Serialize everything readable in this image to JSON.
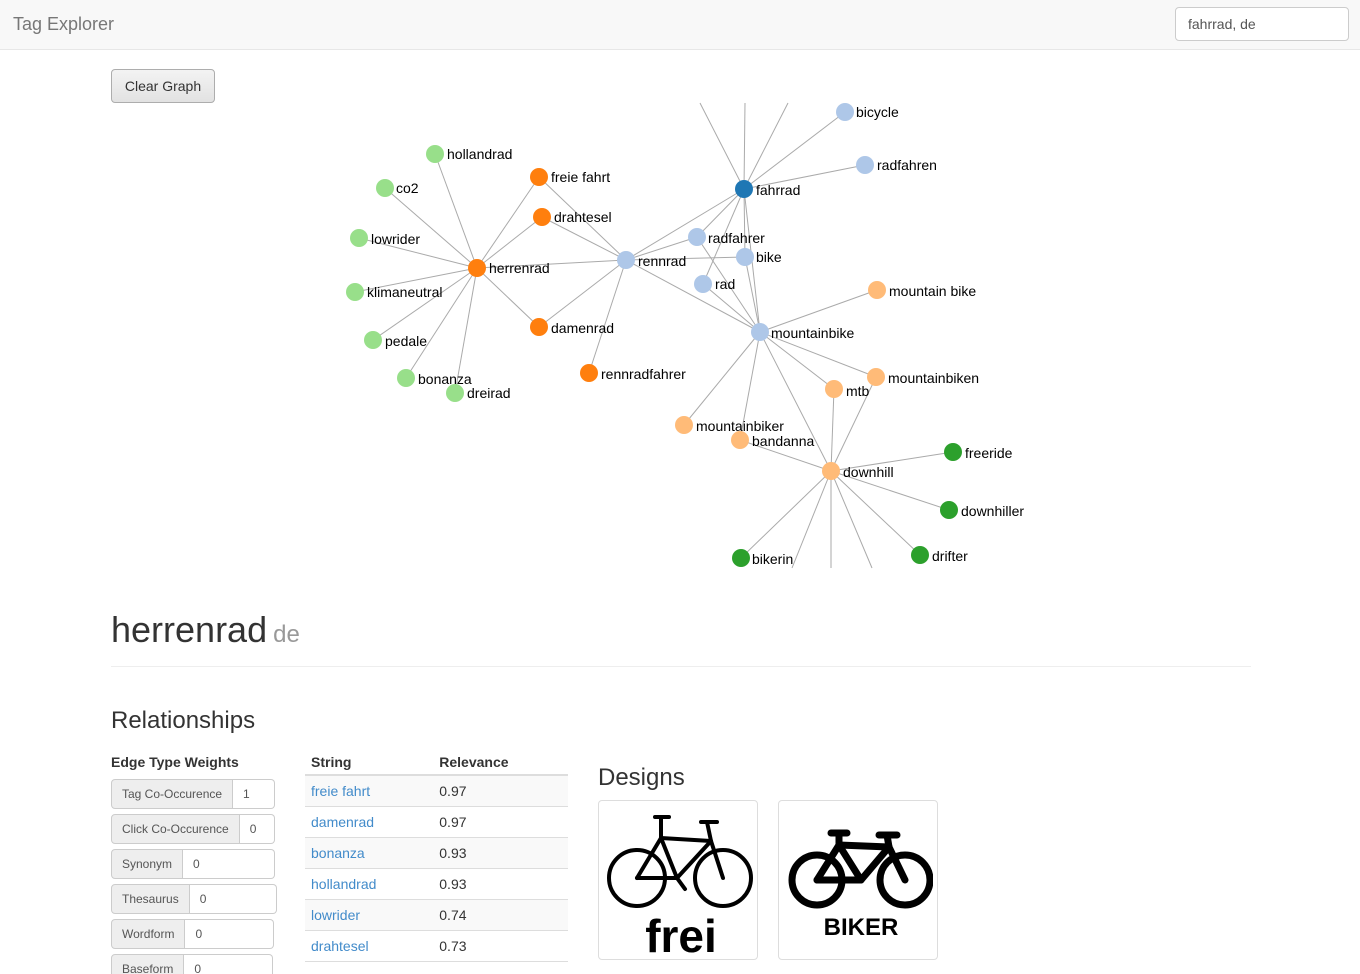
{
  "navbar": {
    "brand": "Tag Explorer",
    "search_value": "fahrrad, de"
  },
  "toolbar": {
    "clear_label": "Clear Graph"
  },
  "graph": {
    "nodes": {
      "bicycle": "bicycle",
      "radfahren": "radfahren",
      "fahrrad": "fahrrad",
      "hollandrad": "hollandrad",
      "freie_fahrt": "freie fahrt",
      "co2": "co2",
      "drahtesel": "drahtesel",
      "lowrider": "lowrider",
      "radfahrer": "radfahrer",
      "bike": "bike",
      "herrenrad": "herrenrad",
      "rennrad": "rennrad",
      "rad": "rad",
      "klimaneutral": "klimaneutral",
      "mountain_bike": "mountain bike",
      "damenrad": "damenrad",
      "mountainbike": "mountainbike",
      "pedale": "pedale",
      "rennradfahrer": "rennradfahrer",
      "mountainbiken": "mountainbiken",
      "bonanza": "bonanza",
      "mtb": "mtb",
      "dreirad": "dreirad",
      "mountainbiker": "mountainbiker",
      "bandanna": "bandanna",
      "freeride": "freeride",
      "downhill": "downhill",
      "downhiller": "downhiller",
      "drifter": "drifter",
      "bikerin": "bikerin"
    },
    "colors": {
      "light_green": "#98df8a",
      "dark_orange": "#ff7f0e",
      "light_orange": "#ffbb78",
      "light_blue": "#aec7e8",
      "dark_blue": "#1f77b4",
      "dark_green": "#2ca02c"
    }
  },
  "tag": {
    "name": "herrenrad",
    "lang": "de"
  },
  "relationships": {
    "title": "Relationships",
    "edge_weights_title": "Edge Type Weights",
    "weights": [
      {
        "label": "Tag Co-Occurence",
        "value": "1"
      },
      {
        "label": "Click Co-Occurence",
        "value": "0"
      },
      {
        "label": "Synonym",
        "value": "0"
      },
      {
        "label": "Thesaurus",
        "value": "0"
      },
      {
        "label": "Wordform",
        "value": "0"
      },
      {
        "label": "Baseform",
        "value": "0"
      }
    ],
    "table": {
      "col_string": "String",
      "col_relevance": "Relevance",
      "rows": [
        {
          "string": "freie fahrt",
          "relevance": "0.97"
        },
        {
          "string": "damenrad",
          "relevance": "0.97"
        },
        {
          "string": "bonanza",
          "relevance": "0.93"
        },
        {
          "string": "hollandrad",
          "relevance": "0.93"
        },
        {
          "string": "lowrider",
          "relevance": "0.74"
        },
        {
          "string": "drahtesel",
          "relevance": "0.73"
        }
      ]
    }
  },
  "designs": {
    "title": "Designs",
    "items": [
      {
        "caption": "frei",
        "icon": "bicycle-outline-icon"
      },
      {
        "caption": "BIKER",
        "icon": "bicycle-bold-icon"
      }
    ]
  }
}
